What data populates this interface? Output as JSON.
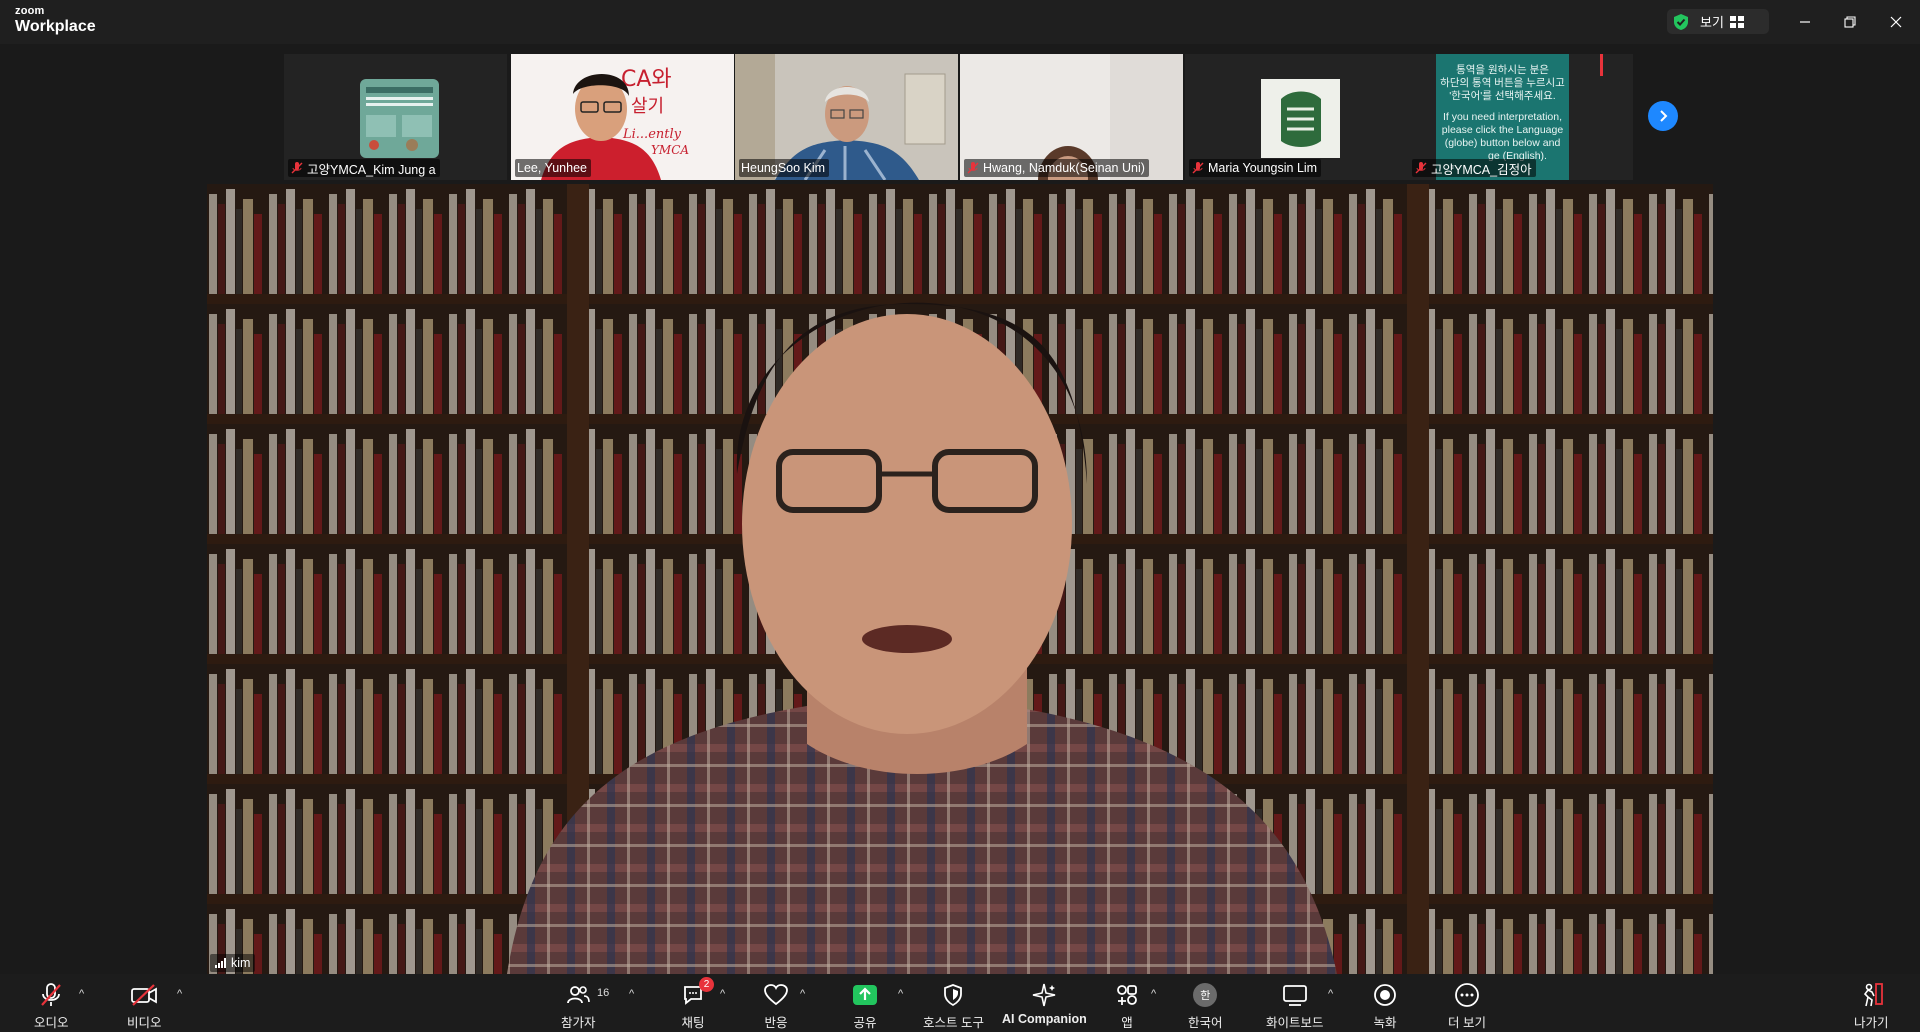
{
  "app": {
    "brand_small": "zoom",
    "brand_large": "Workplace"
  },
  "titlebar": {
    "view_label": "보기"
  },
  "participants": [
    {
      "name": "고양YMCA_Kim Jung a",
      "muted": true
    },
    {
      "name": "Lee, Yunhee",
      "muted": false,
      "sign_text": [
        "CA와",
        "살기",
        "Li...ently",
        "YMCA"
      ]
    },
    {
      "name": "HeungSoo Kim",
      "muted": false
    },
    {
      "name": "Hwang, Namduk(Seinan Uni)",
      "muted": true
    },
    {
      "name": "Maria Youngsin Lim",
      "muted": true
    },
    {
      "name": "고양YMCA_김정아",
      "muted": true,
      "notice": [
        "통역을 원하시는 분은",
        "하단의 통역 버튼을 누르시고",
        "'한국어'를 선택해주세요.",
        "",
        "If you need interpretation,",
        "please click the Language",
        "(globe) button below and",
        "ge (English)."
      ]
    }
  ],
  "main_speaker": {
    "name": "kim"
  },
  "toolbar": {
    "audio": "오디오",
    "video": "비디오",
    "participants": "참가자",
    "participants_count": "16",
    "chat": "채팅",
    "chat_badge": "2",
    "react": "반응",
    "share": "공유",
    "host_tools": "호스트 도구",
    "ai_companion": "AI Companion",
    "apps": "앱",
    "interpretation": "한국어",
    "interpretation_glyph": "한",
    "whiteboard": "화이트보드",
    "record": "녹화",
    "more": "더 보기",
    "leave": "나가기"
  },
  "colors": {
    "accent_blue": "#1e88ff",
    "share_green": "#22c55e",
    "mute_red": "#e8333b",
    "shield_green": "#23c55e"
  }
}
